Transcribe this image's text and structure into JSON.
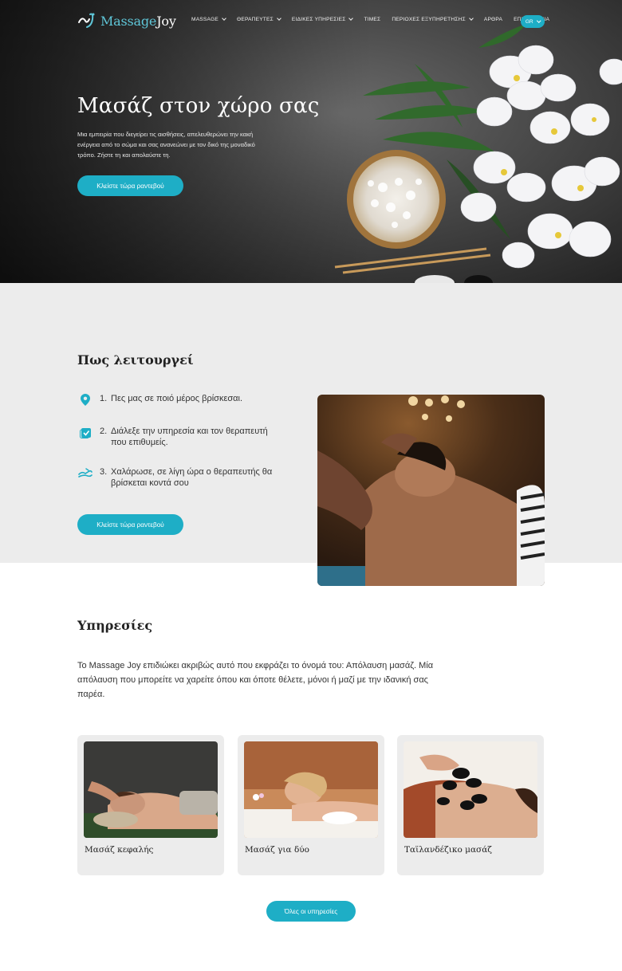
{
  "brand": {
    "name_part1": "Massage",
    "name_part2": "Joy"
  },
  "nav": {
    "items": [
      {
        "label": "MASSAGE",
        "dropdown": true
      },
      {
        "label": "ΘΕΡΑΠΕΥΤΕΣ",
        "dropdown": true
      },
      {
        "label": "ΕΙΔΙΚΕΣ ΥΠΗΡΕΣΙΕΣ",
        "dropdown": true
      },
      {
        "label": "ΤΙΜΕΣ",
        "dropdown": false
      },
      {
        "label": "ΠΕΡΙΟΧΕΣ ΕΞΥΠΗΡΕΤΗΣΗΣ",
        "dropdown": true
      },
      {
        "label": "ΑΡΘΡΑ",
        "dropdown": false
      },
      {
        "label": "ΕΠΙΚΟΙΝΩΝΙΑ",
        "dropdown": false
      }
    ],
    "language": "GR"
  },
  "hero": {
    "title": "Μασάζ στον χώρο σας",
    "subtitle": "Μια εμπειρία που διεγείρει τις αισθήσεις, απελευθερώνει την κακή ενέργεια από το σώμα και σας ανανεώνει με τον δικό της μοναδικό τρόπο. Ζήστε τη και απολαύστε τη.",
    "cta": "Κλείστε τώρα ραντεβού"
  },
  "how": {
    "title": "Πως λειτουργεί",
    "steps": [
      {
        "num": "1.",
        "text": "Πες μας σε ποιό μέρος βρίσκεσαι.",
        "icon": "location-pin-icon"
      },
      {
        "num": "2.",
        "text": "Διάλεξε την υπηρεσία και τον θεραπευτή που επιθυμείς.",
        "icon": "checkbox-icon"
      },
      {
        "num": "3.",
        "text": "Χαλάρωσε, σε λίγη ώρα ο θεραπευτής θα βρίσκεται κοντά σου",
        "icon": "relax-hand-icon"
      }
    ],
    "cta": "Κλείστε τώρα ραντεβού"
  },
  "services": {
    "title": "Υπηρεσίες",
    "intro": "Το Massage Joy επιδιώκει ακριβώς αυτό που εκφράζει το όνομά του: Απόλαυση μασάζ. Μία απόλαυση που μπορείτε να χαρείτε όπου και όποτε θέλετε, μόνοι ή μαζί με την ιδανική σας παρέα.",
    "cards": [
      {
        "title": "Μασάζ κεφαλής"
      },
      {
        "title": "Μασάζ για δύο"
      },
      {
        "title": "Ταϊλανδέζικο μασάζ"
      }
    ],
    "all_button": "Όλες οι υπηρεσίες"
  },
  "colors": {
    "accent": "#1eaec6",
    "section_bg": "#ececec"
  }
}
